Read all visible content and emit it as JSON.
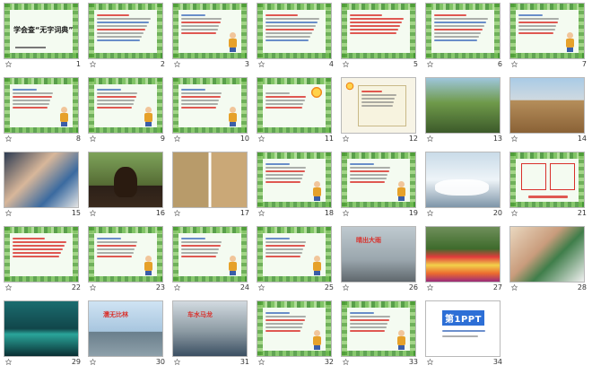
{
  "view": "slide-sorter",
  "colors": {
    "accent_red": "#d9302b",
    "frame_green": "#4e9e35",
    "number_text": "#333333"
  },
  "slides": [
    {
      "num": "1",
      "kind": "title",
      "title": "学会查“无字词典”"
    },
    {
      "num": "2",
      "kind": "text"
    },
    {
      "num": "3",
      "kind": "text-figure"
    },
    {
      "num": "4",
      "kind": "text"
    },
    {
      "num": "5",
      "kind": "text-red"
    },
    {
      "num": "6",
      "kind": "text"
    },
    {
      "num": "7",
      "kind": "text-figure"
    },
    {
      "num": "8",
      "kind": "text-figure"
    },
    {
      "num": "9",
      "kind": "text-figure"
    },
    {
      "num": "10",
      "kind": "text-figure"
    },
    {
      "num": "11",
      "kind": "photo-text",
      "photo": "sun"
    },
    {
      "num": "12",
      "kind": "scroll"
    },
    {
      "num": "13",
      "kind": "photo",
      "photo": "trees"
    },
    {
      "num": "14",
      "kind": "photo",
      "photo": "cracked-earth"
    },
    {
      "num": "15",
      "kind": "photo",
      "photo": "people"
    },
    {
      "num": "16",
      "kind": "photo",
      "photo": "dog"
    },
    {
      "num": "17",
      "kind": "photo",
      "photo": "drought-pair"
    },
    {
      "num": "18",
      "kind": "text-figure"
    },
    {
      "num": "19",
      "kind": "text-figure"
    },
    {
      "num": "20",
      "kind": "photo",
      "photo": "snow"
    },
    {
      "num": "21",
      "kind": "text-boxes"
    },
    {
      "num": "22",
      "kind": "text-red"
    },
    {
      "num": "23",
      "kind": "text-figure"
    },
    {
      "num": "24",
      "kind": "text-figure"
    },
    {
      "num": "25",
      "kind": "text-figure"
    },
    {
      "num": "26",
      "kind": "photo-caption",
      "photo": "street",
      "caption": "晴出大雨"
    },
    {
      "num": "27",
      "kind": "photo",
      "photo": "flowers"
    },
    {
      "num": "28",
      "kind": "photo",
      "photo": "kids"
    },
    {
      "num": "29",
      "kind": "photo",
      "photo": "night-city"
    },
    {
      "num": "30",
      "kind": "photo-caption",
      "photo": "shanghai",
      "caption": "濡无比林"
    },
    {
      "num": "31",
      "kind": "photo-caption",
      "photo": "street2",
      "caption": "车水马龙"
    },
    {
      "num": "32",
      "kind": "text-figure"
    },
    {
      "num": "33",
      "kind": "text-figure"
    },
    {
      "num": "34",
      "kind": "logo",
      "logo": "第1PPT"
    }
  ]
}
